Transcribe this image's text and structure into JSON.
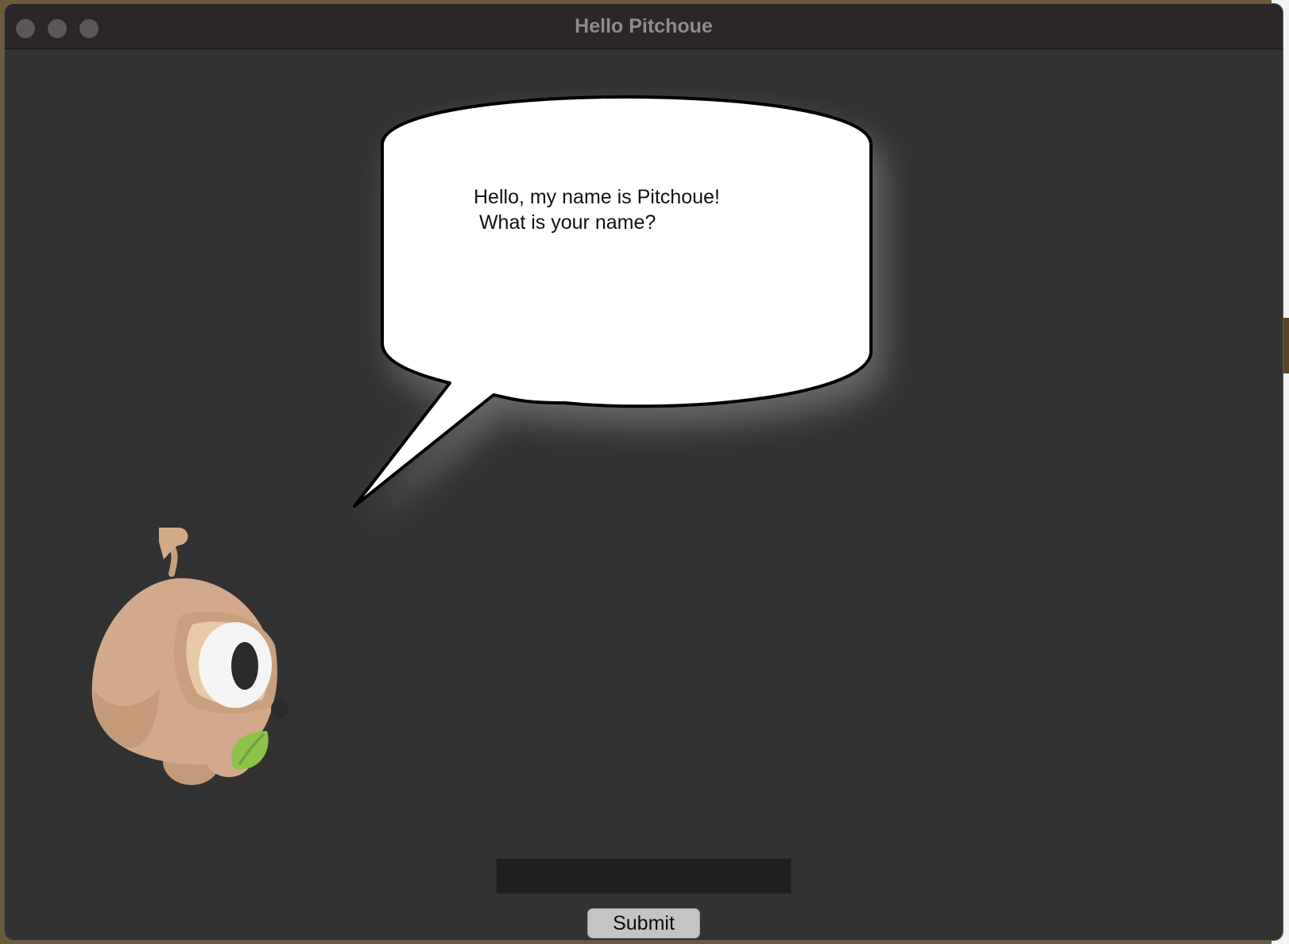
{
  "window": {
    "title": "Hello Pitchoue"
  },
  "speech_bubble": {
    "text": "Hello, my name is Pitchoue!\n What is your name?"
  },
  "name_input": {
    "value": "",
    "placeholder": ""
  },
  "submit_button": {
    "label": "Submit"
  },
  "colors": {
    "window_background": "#323232",
    "titlebar_background": "#2a2726",
    "bubble_fill": "#ffffff",
    "bubble_outline": "#000000",
    "input_background": "#1f1f1f",
    "button_background": "#c4c4c4",
    "mascot_body": "#d2a98a",
    "mascot_leaf": "#8bc34a"
  },
  "icons": {
    "mascot": "pitchoue-sloth-mascot"
  }
}
